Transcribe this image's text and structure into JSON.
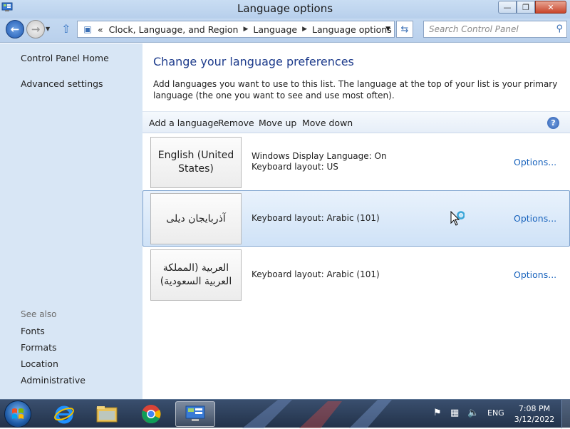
{
  "window": {
    "title": "Language options",
    "buttons": {
      "minimize": "—",
      "maximize": "❐",
      "close": "✕"
    }
  },
  "navbar": {
    "breadcrumb": [
      "Clock, Language, and Region",
      "Language",
      "Language options"
    ],
    "overflow": "«",
    "search_placeholder": "Search Control Panel"
  },
  "sidebar": {
    "links": [
      "Control Panel Home",
      "Advanced settings"
    ],
    "see_also_heading": "See also",
    "see_also": [
      "Fonts",
      "Formats",
      "Location",
      "Administrative"
    ]
  },
  "main": {
    "title": "Change your language preferences",
    "description": "Add languages you want to use to this list. The language at the top of your list is your primary language (the one you want to see and use most often).",
    "toolbar": [
      "Add a language",
      "Remove",
      "Move up",
      "Move down"
    ],
    "help": "?",
    "languages": [
      {
        "name": "English (United States)",
        "info": [
          "Windows Display Language: On",
          "Keyboard layout: US"
        ],
        "options": "Options...",
        "selected": false
      },
      {
        "name": "آذربایجان دیلی",
        "info": [
          "Keyboard layout: Arabic (101)"
        ],
        "options": "Options...",
        "selected": true
      },
      {
        "name": "العربية (المملكة العربية السعودية)",
        "info": [
          "Keyboard layout: Arabic (101)"
        ],
        "options": "Options...",
        "selected": false
      }
    ]
  },
  "taskbar": {
    "apps": [
      "Internet Explorer",
      "File Explorer",
      "Google Chrome",
      "Control Panel"
    ],
    "active_app": "Control Panel",
    "language": "ENG",
    "time": "7:08 PM",
    "date": "3/12/2022"
  }
}
